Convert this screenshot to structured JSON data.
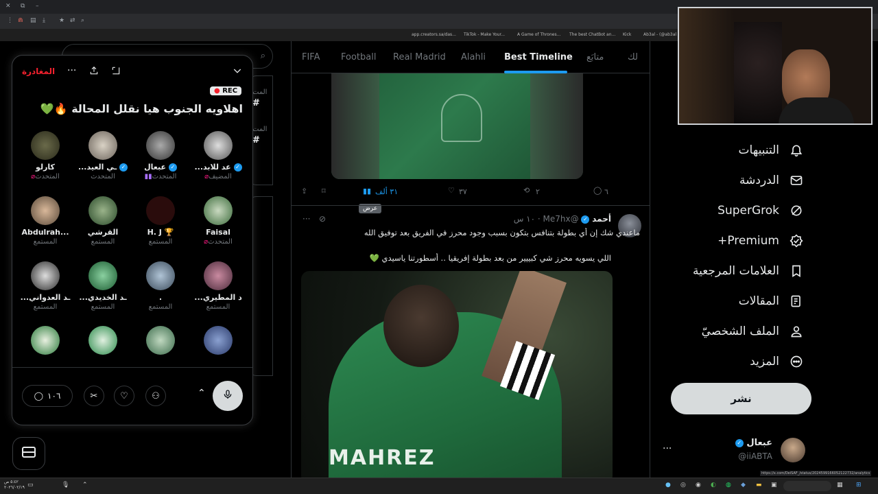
{
  "browser": {
    "bookmarks": [
      "app.creators.sa/das...",
      "TikTok - Make Your...",
      "A Game of Thrones...",
      "The best ChatBot an...",
      "Kick",
      "Ab3al - (@ab3al )..."
    ],
    "status_url": "https://x.com/DeiSAF_/status/2024599166052122732/analytics"
  },
  "nav": {
    "items": [
      {
        "label": "التنبيهات",
        "icon": "bell-icon"
      },
      {
        "label": "الدردشة",
        "icon": "envelope-icon"
      },
      {
        "label": "SuperGrok",
        "icon": "grok-icon"
      },
      {
        "label": "Premium+",
        "icon": "premium-icon"
      },
      {
        "label": "العلامات المرجعية",
        "icon": "bookmark-icon"
      },
      {
        "label": "المقالات",
        "icon": "article-icon"
      },
      {
        "label": "الملف الشخصيّ",
        "icon": "profile-icon"
      },
      {
        "label": "المزيد",
        "icon": "more-icon"
      }
    ],
    "post_button": "نشر",
    "account": {
      "name": "عبعال",
      "handle": "@iiABTA",
      "more": "···"
    }
  },
  "tabs": [
    "لك",
    "متابَع",
    "Best Timeline",
    "Alahli",
    "Real Madrid",
    "Football",
    "FIFA"
  ],
  "active_tab": "Best Timeline",
  "tweet1": {
    "replies": "٦",
    "reposts": "٢",
    "likes": "٣٧",
    "views": "٣١ ألف",
    "tooltip": "عرض"
  },
  "tweet2": {
    "name": "أحمد",
    "handle": "@Me7hx",
    "time": "١٠ س",
    "line1": "ماعندي شك إن أي بطولة بتنافس بتكون بسبب وجود محرز في الفريق بعد توفيق الله",
    "line2": "اللي يسويه محرز شي كبييير من بعد بطولة إفريقيا .. أسطورتنا ياسيدي 💚",
    "more": "···"
  },
  "spaces": {
    "leave": "المغادرة",
    "rec": "REC",
    "title": "اهلاويه الجنوب هيا نقلل المحالة 🔥💚",
    "participants": [
      {
        "name": "...عد للابد",
        "role": "المضيف"
      },
      {
        "name": "عبعال",
        "role": "المتحدث"
      },
      {
        "name": "...ـي العيد",
        "role": "المتحدث"
      },
      {
        "name": "كارلو",
        "role": "المتحدث"
      },
      {
        "name": "Faisal",
        "role": "المتحدث"
      },
      {
        "name": "H. J 🏆",
        "role": "المستمع"
      },
      {
        "name": "القرشي",
        "role": "المستمع"
      },
      {
        "name": "Abdulrah...",
        "role": "المستمع"
      },
      {
        "name": "...د المطيري",
        "role": "المستمع"
      },
      {
        "name": ".",
        "role": "المستمع"
      },
      {
        "name": "...ـد الخديدي",
        "role": "المستمع"
      },
      {
        "name": "...ـد العدواني",
        "role": "المستمع"
      }
    ],
    "comments_count": "١٠٦"
  },
  "left_partial": [
    "#",
    "المت",
    "#",
    "المت"
  ],
  "taskbar": {
    "time": "٥:٤٢ ص",
    "date": "٢٠٢٦/٠٢/١٩"
  }
}
